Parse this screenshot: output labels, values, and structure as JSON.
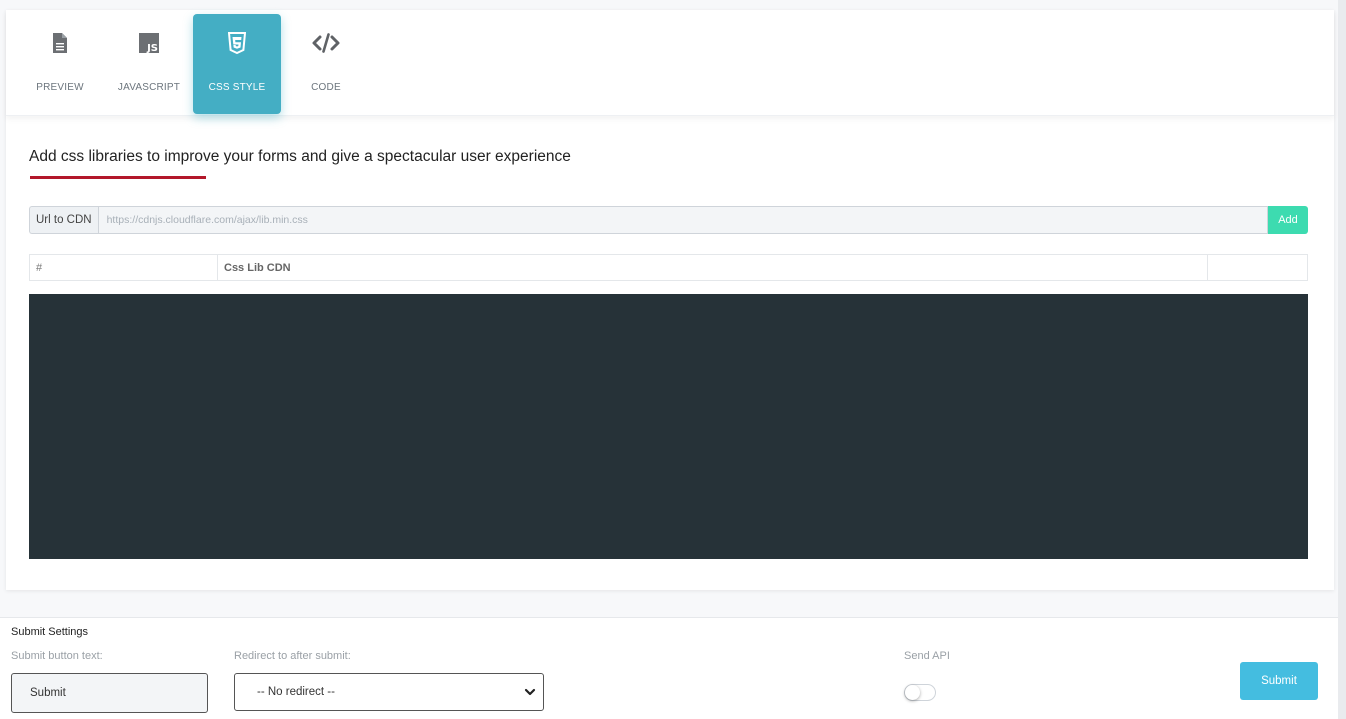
{
  "tabs": [
    {
      "label": "PREVIEW",
      "icon": "file-icon"
    },
    {
      "label": "JAVASCRIPT",
      "icon": "js-icon"
    },
    {
      "label": "CSS STYLE",
      "icon": "css3-icon",
      "active": true
    },
    {
      "label": "CODE",
      "icon": "code-icon"
    }
  ],
  "css_section": {
    "heading": "Add css libraries to improve your forms and give a spectacular user experience",
    "cdn_label": "Url to CDN",
    "cdn_placeholder": "https://cdnjs.cloudflare.com/ajax/lib.min.css",
    "cdn_value": "",
    "add_label": "Add",
    "table_headers": [
      "#",
      "Css Lib CDN",
      ""
    ],
    "table_rows": []
  },
  "submit_settings": {
    "title": "Submit Settings",
    "button_text_label": "Submit button text:",
    "button_text_value": "Submit",
    "redirect_label": "Redirect to after submit:",
    "redirect_value": "-- No redirect --",
    "send_api_label": "Send API",
    "send_api_enabled": false,
    "submit_label": "Submit"
  },
  "colors": {
    "active_tab": "#44aec4",
    "heading_underline": "#b3172a",
    "add_button": "#3ddbb0",
    "editor_bg": "#263238",
    "submit_button": "#44bde0"
  }
}
